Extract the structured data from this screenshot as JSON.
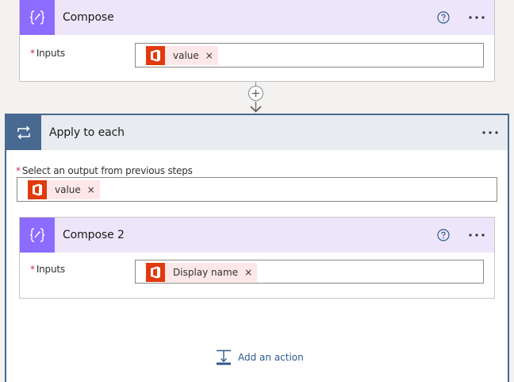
{
  "compose1": {
    "title": "Compose",
    "inputs_label": "Inputs",
    "token": {
      "label": "value"
    }
  },
  "loop": {
    "title": "Apply to each",
    "select_label": "Select an output from previous steps",
    "token": {
      "label": "value"
    }
  },
  "compose2": {
    "title": "Compose 2",
    "inputs_label": "Inputs",
    "token": {
      "label": "Display name"
    }
  },
  "add_action": {
    "label": "Add an action"
  },
  "symbols": {
    "required": "*",
    "remove": "×"
  },
  "icons": {
    "compose": "curly-braces-icon",
    "loop": "loop-arrows-icon",
    "office": "office-logo-icon",
    "help": "question-circle-icon",
    "more": "ellipsis-icon",
    "add": "plus-icon",
    "add_action": "insert-action-icon"
  },
  "colors": {
    "compose_accent": "#8c6cff",
    "compose_header": "#ede6fb",
    "loop_accent": "#486991",
    "loop_header": "#e8ebf0",
    "office": "#e03a0d",
    "token_bg": "#fde7e9",
    "link": "#2f5b8c",
    "required": "#c4314b"
  }
}
